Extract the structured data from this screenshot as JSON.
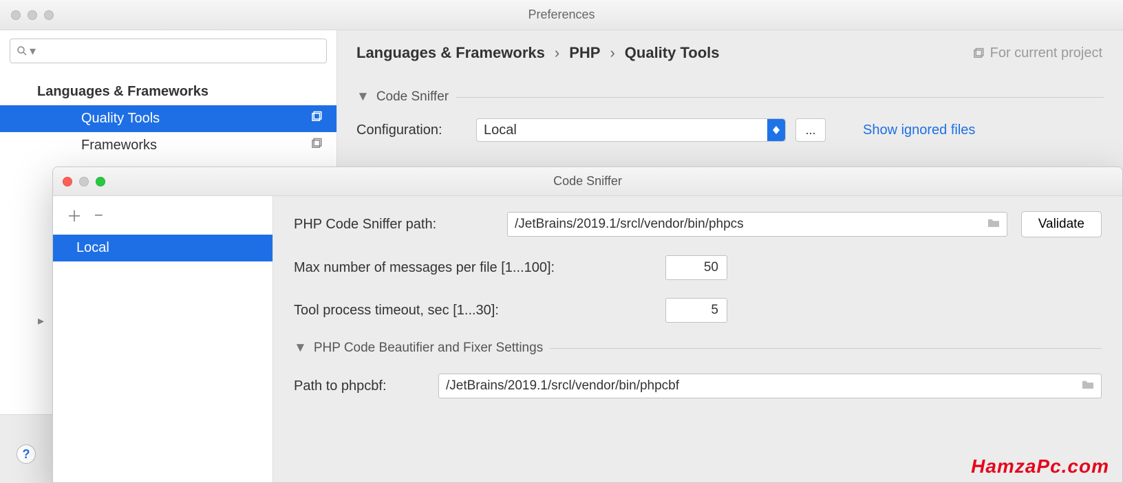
{
  "prefs": {
    "title": "Preferences",
    "search_placeholder": "",
    "sidebar": {
      "group": "Languages & Frameworks",
      "items": [
        {
          "label": "Quality Tools"
        },
        {
          "label": "Frameworks"
        }
      ]
    },
    "breadcrumb": {
      "a": "Languages & Frameworks",
      "b": "PHP",
      "c": "Quality Tools"
    },
    "for_project": "For current project",
    "section_code_sniffer": "Code Sniffer",
    "config_label": "Configuration:",
    "config_value": "Local",
    "ellipsis": "...",
    "show_ignored": "Show ignored files"
  },
  "dialog": {
    "title": "Code Sniffer",
    "list_item": "Local",
    "phpcs_label": "PHP Code Sniffer path:",
    "phpcs_value": "/JetBrains/2019.1/srcl/vendor/bin/phpcs",
    "validate": "Validate",
    "max_label": "Max number of messages per file [1...100]:",
    "max_value": "50",
    "timeout_label": "Tool process timeout, sec [1...30]:",
    "timeout_value": "5",
    "section_beautifier": "PHP Code Beautifier and Fixer Settings",
    "phpcbf_label": "Path to phpcbf:",
    "phpcbf_value": "/JetBrains/2019.1/srcl/vendor/bin/phpcbf"
  },
  "watermark": "HamzaPc.com"
}
